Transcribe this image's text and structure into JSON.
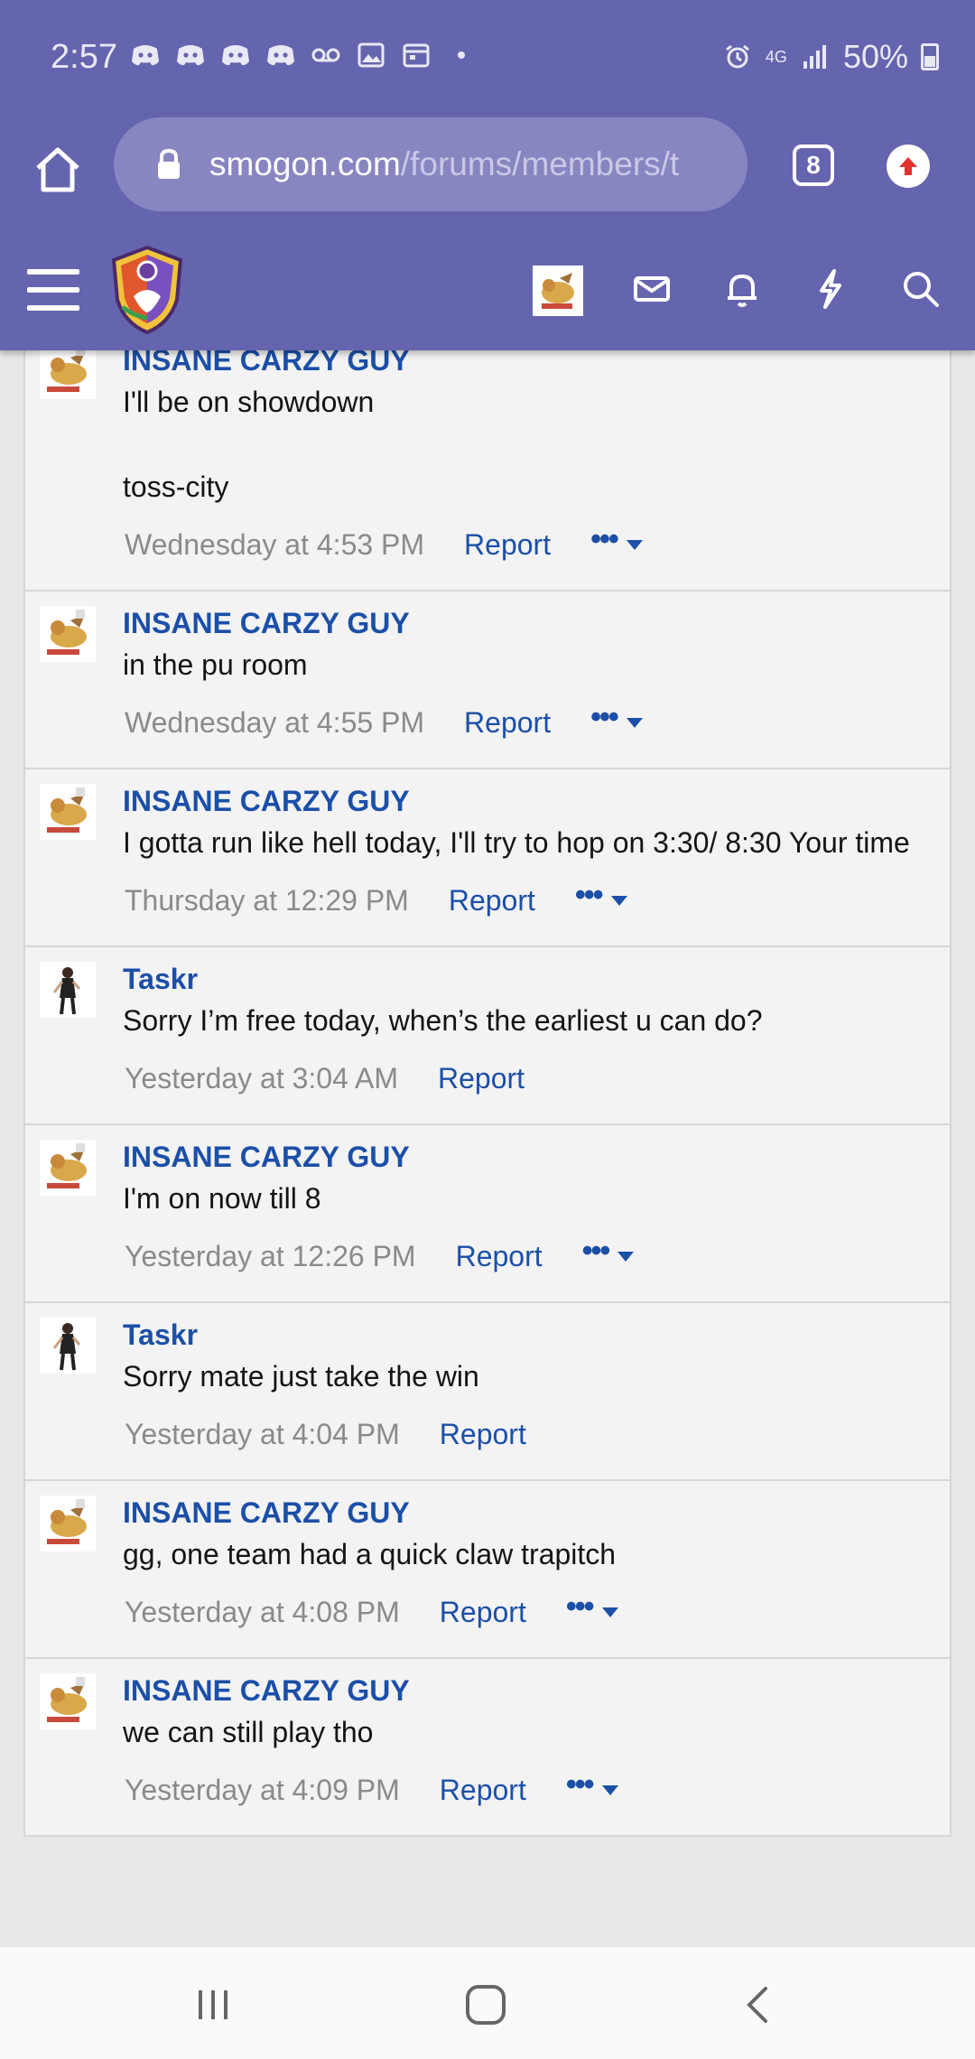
{
  "status_bar": {
    "time": "2:57",
    "network": "4G",
    "battery": "50%",
    "icons": [
      "discord-icon",
      "discord-icon",
      "discord-icon",
      "discord-icon",
      "voicemail-icon",
      "gallery-icon",
      "calendar-icon",
      "dot-icon",
      "alarm-icon",
      "signal-icon",
      "battery-icon"
    ]
  },
  "browser": {
    "url_host": "smogon.com",
    "url_path": "/forums/members/t",
    "tab_count": "8"
  },
  "colors": {
    "header_bg": "#6564ae",
    "link": "#1b4fa8",
    "muted": "#8a8a8a"
  },
  "messages": [
    {
      "author": "INSANE CARZY GUY",
      "text": "I'll be on showdown\n\ntoss-city",
      "date": "Wednesday at 4:53 PM",
      "report": "Report",
      "more": "•••",
      "has_more": true
    },
    {
      "author": "INSANE CARZY GUY",
      "text": "in the pu room",
      "date": "Wednesday at 4:55 PM",
      "report": "Report",
      "more": "•••",
      "has_more": true
    },
    {
      "author": "INSANE CARZY GUY",
      "text": "I gotta run like hell today, I'll try to hop on 3:30/ 8:30 Your time",
      "date": "Thursday at 12:29 PM",
      "report": "Report",
      "more": "•••",
      "has_more": true
    },
    {
      "author": "Taskr",
      "text": "Sorry I’m free today, when’s the earliest u can do?",
      "date": "Yesterday at 3:04 AM",
      "report": "Report",
      "more": "",
      "has_more": false
    },
    {
      "author": "INSANE CARZY GUY",
      "text": "I'm on now till 8",
      "date": "Yesterday at 12:26 PM",
      "report": "Report",
      "more": "•••",
      "has_more": true
    },
    {
      "author": "Taskr",
      "text": "Sorry mate just take the win",
      "date": "Yesterday at 4:04 PM",
      "report": "Report",
      "more": "",
      "has_more": false
    },
    {
      "author": "INSANE CARZY GUY",
      "text": "gg, one team had a quick claw trapitch",
      "date": "Yesterday at 4:08 PM",
      "report": "Report",
      "more": "•••",
      "has_more": true
    },
    {
      "author": "INSANE CARZY GUY",
      "text": "we can still play tho",
      "date": "Yesterday at 4:09 PM",
      "report": "Report",
      "more": "•••",
      "has_more": true
    }
  ]
}
